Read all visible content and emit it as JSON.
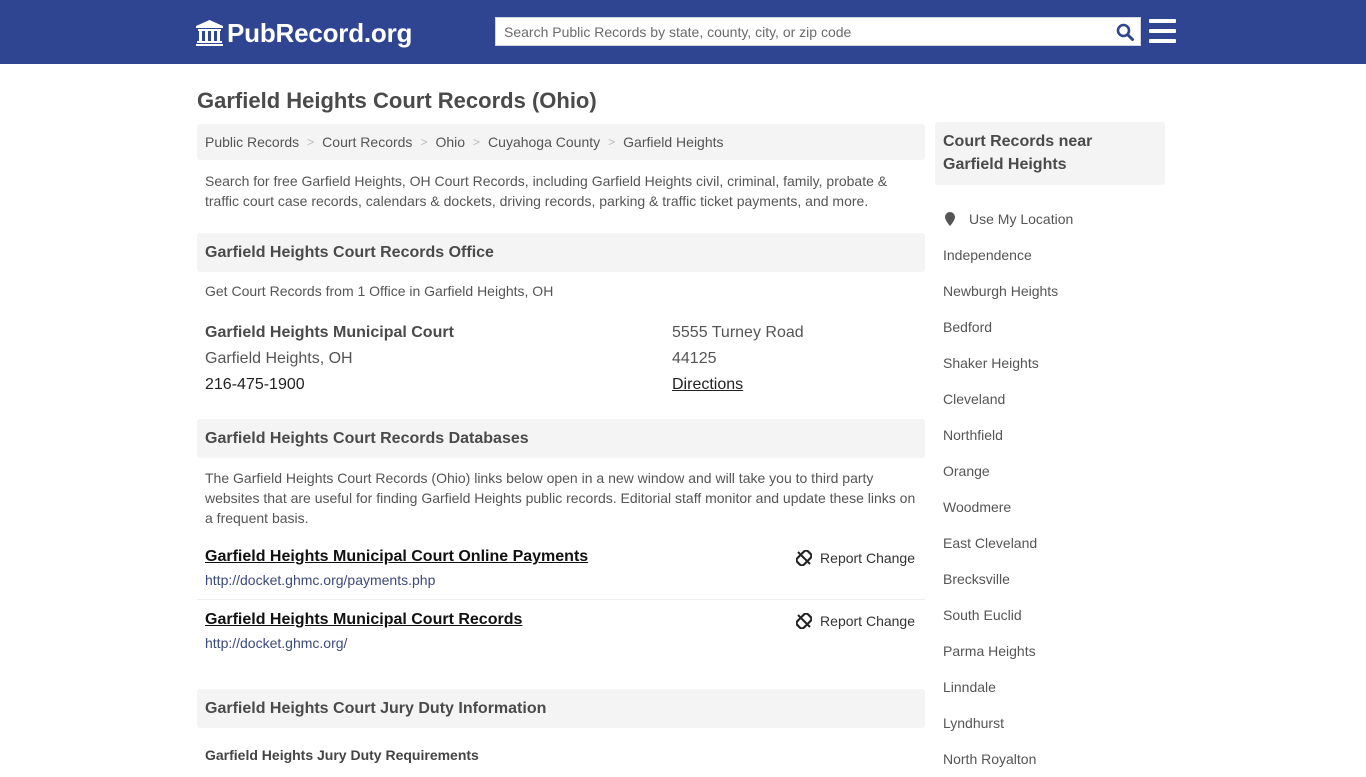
{
  "header": {
    "logo_text": "PubRecord.org",
    "search_placeholder": "Search Public Records by state, county, city, or zip code",
    "search_value": "",
    "colors": {
      "brand": "#2f4592",
      "search_icon": "#2f4592"
    }
  },
  "page": {
    "title": "Garfield Heights Court Records (Ohio)",
    "breadcrumb": [
      "Public Records",
      "Court Records",
      "Ohio",
      "Cuyahoga County",
      "Garfield Heights"
    ],
    "breadcrumb_separator": ">",
    "intro": "Search for free Garfield Heights, OH Court Records, including Garfield Heights civil, criminal, family, probate & traffic court case records, calendars & dockets, driving records, parking & traffic ticket payments, and more."
  },
  "office_section": {
    "heading": "Garfield Heights Court Records Office",
    "subtitle": "Get Court Records from 1 Office in Garfield Heights, OH",
    "office": {
      "name": "Garfield Heights Municipal Court",
      "city_state": "Garfield Heights, OH",
      "phone": "216-475-1900",
      "address": "5555 Turney Road",
      "zip": "44125",
      "directions_label": "Directions"
    }
  },
  "databases_section": {
    "heading": "Garfield Heights Court Records Databases",
    "description": "The Garfield Heights Court Records (Ohio) links below open in a new window and will take you to third party websites that are useful for finding Garfield Heights public records. Editorial staff monitor and update these links on a frequent basis.",
    "report_label": "Report Change",
    "links": [
      {
        "title": "Garfield Heights Municipal Court Online Payments",
        "url": "http://docket.ghmc.org/payments.php"
      },
      {
        "title": "Garfield Heights Municipal Court Records",
        "url": "http://docket.ghmc.org/"
      }
    ]
  },
  "jury_section": {
    "heading": "Garfield Heights Court Jury Duty Information",
    "subheading": "Garfield Heights Jury Duty Requirements"
  },
  "sidebar": {
    "heading": "Court Records near Garfield Heights",
    "use_location_label": "Use My Location",
    "nearby": [
      "Independence",
      "Newburgh Heights",
      "Bedford",
      "Shaker Heights",
      "Cleveland",
      "Northfield",
      "Orange",
      "Woodmere",
      "East Cleveland",
      "Brecksville",
      "South Euclid",
      "Parma Heights",
      "Linndale",
      "Lyndhurst",
      "North Royalton"
    ]
  }
}
